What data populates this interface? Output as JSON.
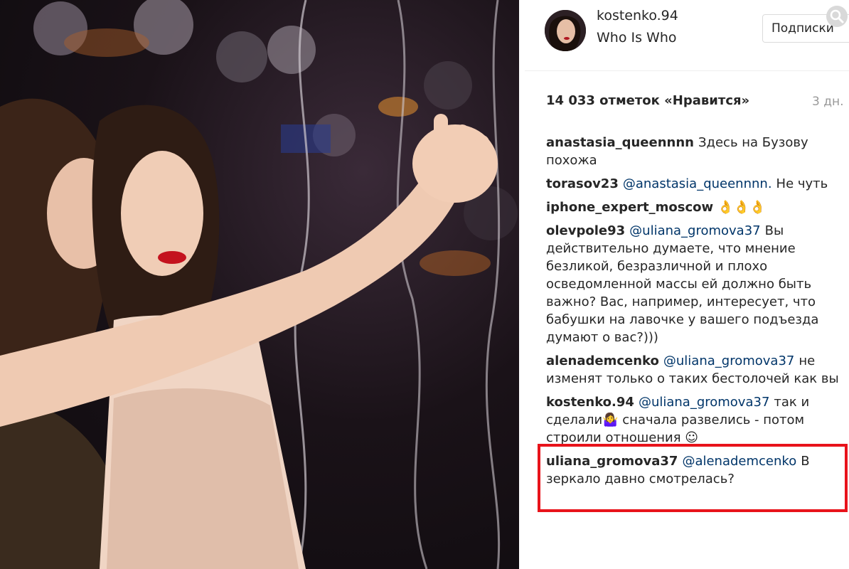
{
  "post": {
    "username": "kostenko.94",
    "location": "Who Is Who",
    "follow_label": "Подписки",
    "likes": "14 033 отметок «Нравится»",
    "time_ago": "3 дн."
  },
  "comments": [
    {
      "author": "anastasia_queennnn",
      "mention": "",
      "text": "Здесь на Бузову похожа"
    },
    {
      "author": "torasov23",
      "mention": "@anastasia_queennnn.",
      "text": "Не чуть"
    },
    {
      "author": "iphone_expert_moscow",
      "mention": "",
      "text": "👌👌👌"
    },
    {
      "author": "olevpole93",
      "mention": "@uliana_gromova37",
      "text": "Вы действительно думаете, что мнение безликой, безразличной и плохо осведомленной массы ей должно быть важно? Вас, например, интересует, что бабушки на лавочке у вашего подъезда думают о вас?)))"
    },
    {
      "author": "alenademcenko",
      "mention": "@uliana_gromova37",
      "text": "не изменят только о таких бестолочей как вы"
    },
    {
      "author": "kostenko.94",
      "mention": "@uliana_gromova37",
      "text": "так и сделали🤷‍♀️ сначала развелись - потом строили отношения ☺"
    },
    {
      "author": "uliana_gromova37",
      "mention": "@alenademcenko",
      "text": "В зеркало давно смотрелась?"
    }
  ],
  "colors": {
    "highlight_border": "#e8131b",
    "mention": "#003569",
    "text": "#262626"
  }
}
